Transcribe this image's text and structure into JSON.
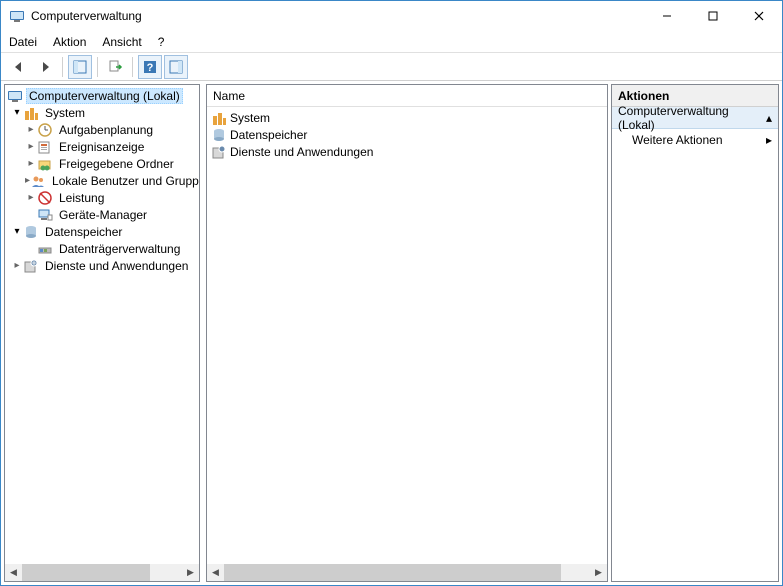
{
  "window": {
    "title": "Computerverwaltung"
  },
  "menu": {
    "file": "Datei",
    "action": "Aktion",
    "view": "Ansicht",
    "help": "?"
  },
  "tree": {
    "root": "Computerverwaltung (Lokal)",
    "system": "System",
    "aufgaben": "Aufgabenplanung",
    "ereignis": "Ereignisanzeige",
    "freigegebene": "Freigegebene Ordner",
    "lokale": "Lokale Benutzer und Gruppen",
    "leistung": "Leistung",
    "geraete": "Geräte-Manager",
    "datenspeicher": "Datenspeicher",
    "datentraeger": "Datenträgerverwaltung",
    "dienste": "Dienste und Anwendungen"
  },
  "list": {
    "col_name": "Name",
    "items": {
      "system": "System",
      "datenspeicher": "Datenspeicher",
      "dienste": "Dienste und Anwendungen"
    }
  },
  "actions": {
    "title": "Aktionen",
    "section": "Computerverwaltung (Lokal)",
    "more": "Weitere Aktionen"
  }
}
